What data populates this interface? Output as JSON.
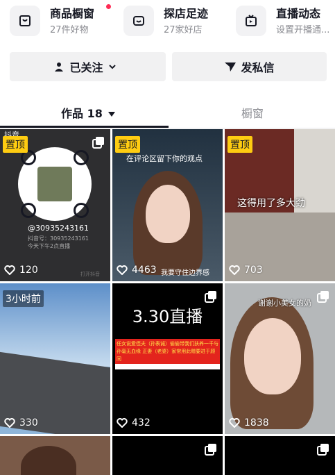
{
  "features": [
    {
      "title": "商品橱窗",
      "subtitle": "27件好物",
      "icon": "storefront-icon"
    },
    {
      "title": "探店足迹",
      "subtitle": "27家好店",
      "icon": "shop-visit-icon"
    },
    {
      "title": "直播动态",
      "subtitle": "设置开播通...",
      "icon": "tv-icon"
    }
  ],
  "actions": {
    "follow": "已关注",
    "message": "发私信"
  },
  "tabs": {
    "works": "作品 18",
    "showcase": "橱窗"
  },
  "grid": [
    {
      "badge": "置顶",
      "likes": "120",
      "qr_account": "@30935243161",
      "qr_line1": "抖音号：30935243161",
      "qr_line2": "今天下午2点直播",
      "brand": "抖音",
      "extra": "打开抖音",
      "kind": "qr"
    },
    {
      "badge": "置顶",
      "likes": "4463",
      "caption": "在评论区留下你的观点",
      "sub": "我要守住边界感",
      "kind": "selfie"
    },
    {
      "badge": "置顶",
      "likes": "703",
      "caption": "这得用了多大劲",
      "kind": "door"
    },
    {
      "time": "3小时前",
      "likes": "330",
      "kind": "road"
    },
    {
      "likes": "432",
      "title": "3.30直播",
      "banner": "任女说爱侄夫（孙表诚）偷偷带我们扶养一千与孙毫无血缘 正妻（老婆）家常用此赠要进于顾同",
      "kind": "text"
    },
    {
      "likes": "1838",
      "caption": "谢谢小美女的奶",
      "kind": "selfie2"
    },
    {
      "kind": "partial1"
    },
    {
      "kind": "partial2"
    },
    {
      "kind": "partial3"
    }
  ],
  "colors": {
    "accent": "#fe2c55",
    "pin": "#fecc11",
    "text": "#161823",
    "muted": "#8a8b91"
  }
}
